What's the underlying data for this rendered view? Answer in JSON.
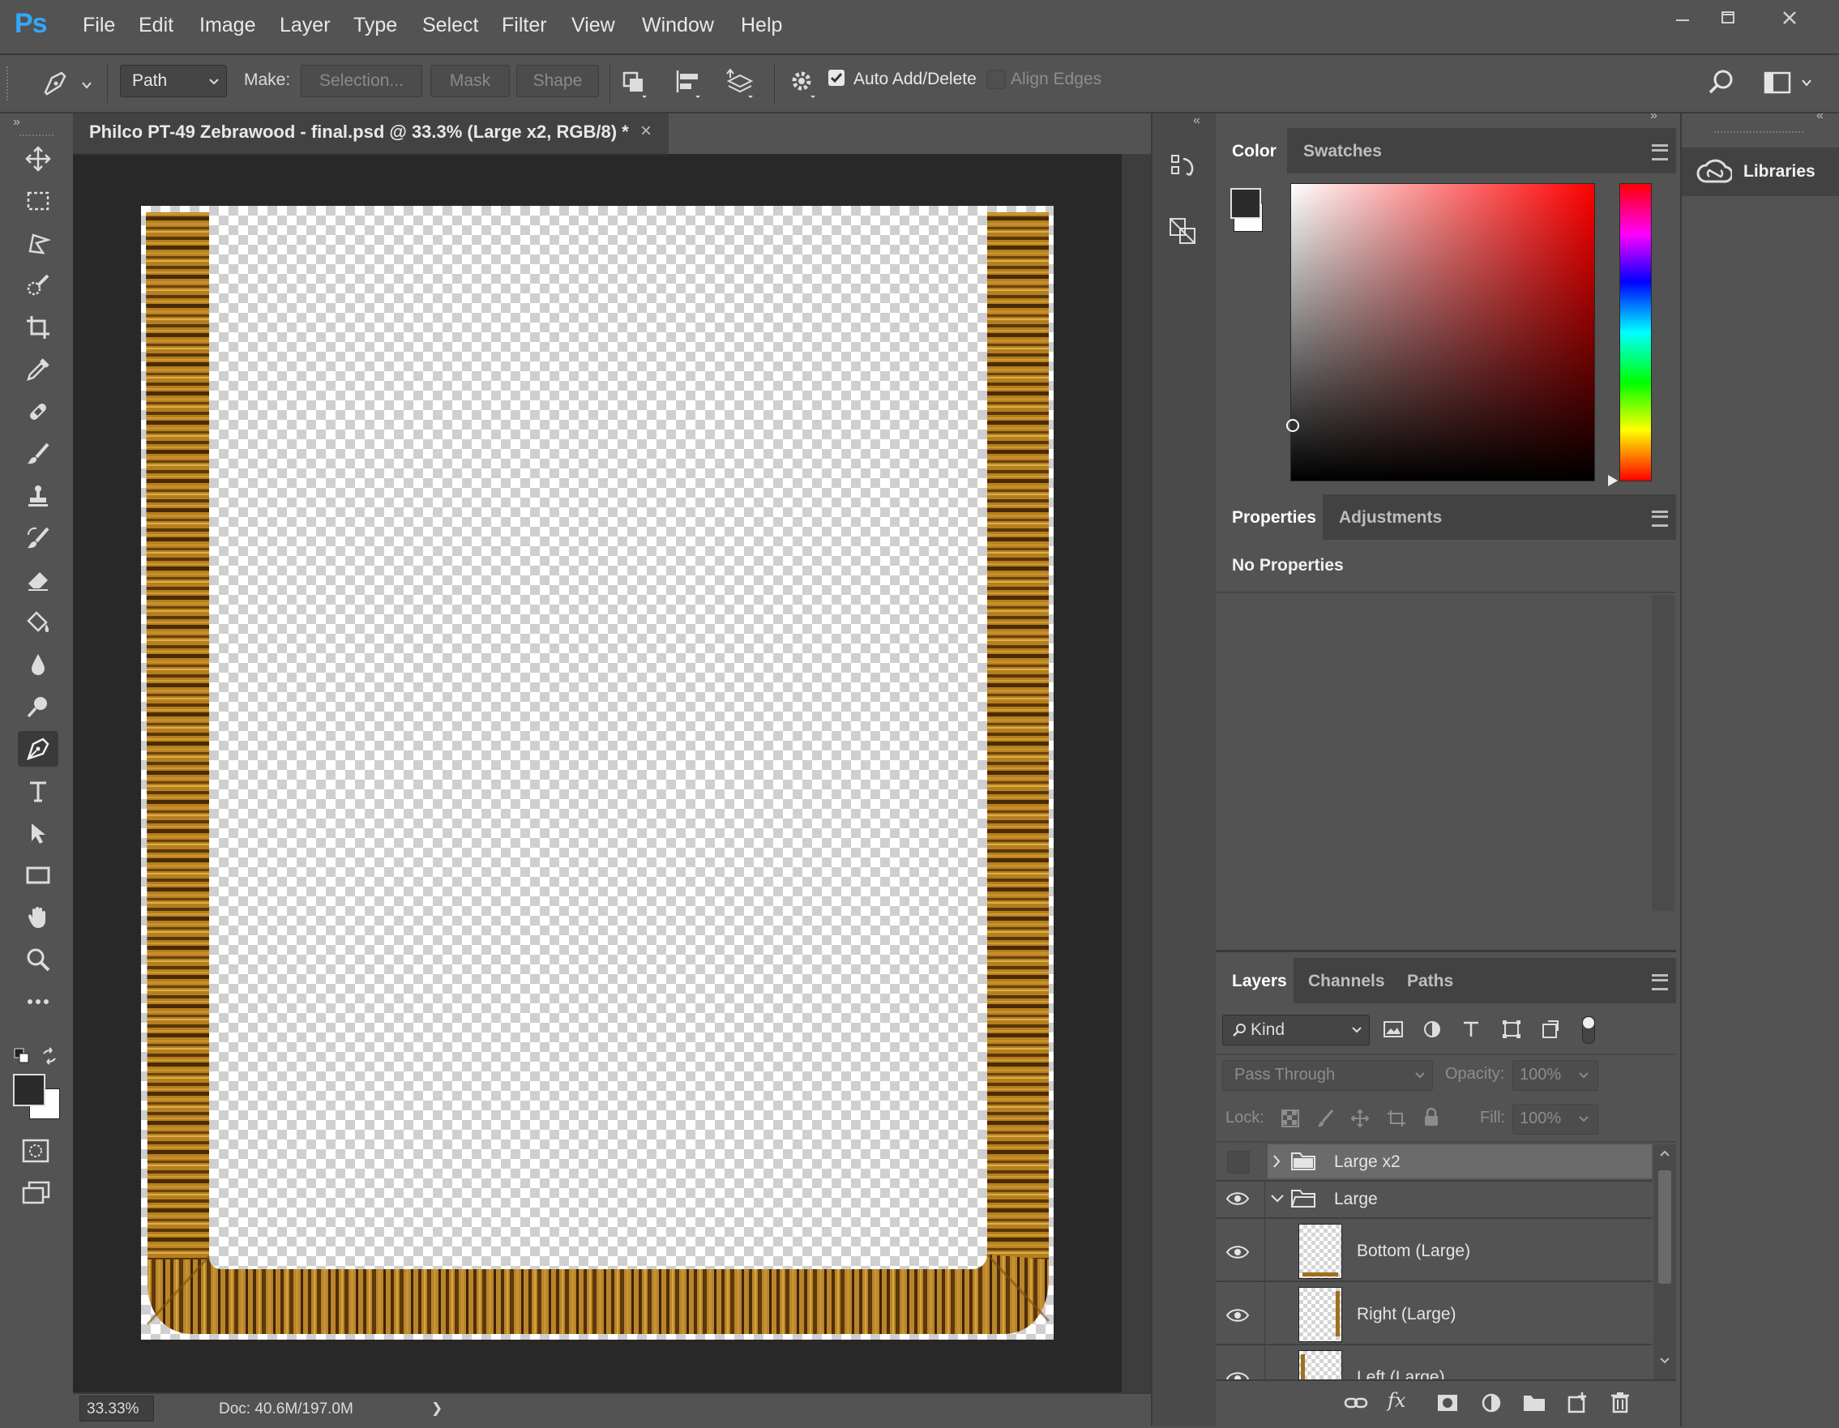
{
  "app": {
    "logo": "Ps"
  },
  "menu": [
    "File",
    "Edit",
    "Image",
    "Layer",
    "Type",
    "Select",
    "Filter",
    "View",
    "Window",
    "Help"
  ],
  "window_controls": {
    "minimize": "minimize-icon",
    "maximize": "maximize-icon",
    "close": "close-icon"
  },
  "options_bar": {
    "tool_icon": "pen-icon",
    "mode": "Path",
    "make_label": "Make:",
    "selection_button": "Selection...",
    "mask_button": "Mask",
    "shape_button": "Shape",
    "auto_add_delete": {
      "label": "Auto Add/Delete",
      "checked": true
    },
    "align_edges": {
      "label": "Align Edges",
      "checked": false
    }
  },
  "document": {
    "tab_title": "Philco PT-49 Zebrawood - final.psd @ 33.3% (Large x2, RGB/8) *",
    "zoom": "33.33%",
    "doc_size": "Doc: 40.6M/197.0M",
    "status_arrow": "❯"
  },
  "tools": [
    "move-tool-icon",
    "marquee-tool-icon",
    "lasso-tool-icon",
    "quick-select-tool-icon",
    "crop-tool-icon",
    "eyedropper-tool-icon",
    "healing-brush-tool-icon",
    "brush-tool-icon",
    "clone-stamp-tool-icon",
    "history-brush-tool-icon",
    "eraser-tool-icon",
    "paint-bucket-tool-icon",
    "blur-tool-icon",
    "dodge-tool-icon",
    "pen-tool-icon",
    "type-tool-icon",
    "path-selection-tool-icon",
    "rectangle-tool-icon",
    "hand-tool-icon",
    "zoom-tool-icon",
    "more-tools-icon"
  ],
  "color_panel": {
    "tabs": [
      "Color",
      "Swatches"
    ],
    "foreground": "#2b2b2b",
    "background": "#ffffff",
    "hue": "#ff0000"
  },
  "properties_panel": {
    "tabs": [
      "Properties",
      "Adjustments"
    ],
    "message": "No Properties"
  },
  "layers_panel": {
    "tabs": [
      "Layers",
      "Channels",
      "Paths"
    ],
    "filter_kind": "Kind",
    "blend_mode": "Pass Through",
    "opacity_label": "Opacity:",
    "opacity": "100%",
    "lock_label": "Lock:",
    "fill_label": "Fill:",
    "fill": "100%",
    "layers": [
      {
        "name": "Large x2",
        "type": "group",
        "visible": false,
        "expanded": false,
        "selected": true
      },
      {
        "name": "Large",
        "type": "group",
        "visible": true,
        "expanded": true,
        "selected": false
      },
      {
        "name": "Bottom (Large)",
        "type": "layer",
        "visible": true,
        "thumb": "bottom"
      },
      {
        "name": "Right (Large)",
        "type": "layer",
        "visible": true,
        "thumb": "right"
      },
      {
        "name": "Left (Large)",
        "type": "layer",
        "visible": true,
        "thumb": "left"
      }
    ]
  },
  "libraries_panel": {
    "title": "Libraries"
  }
}
